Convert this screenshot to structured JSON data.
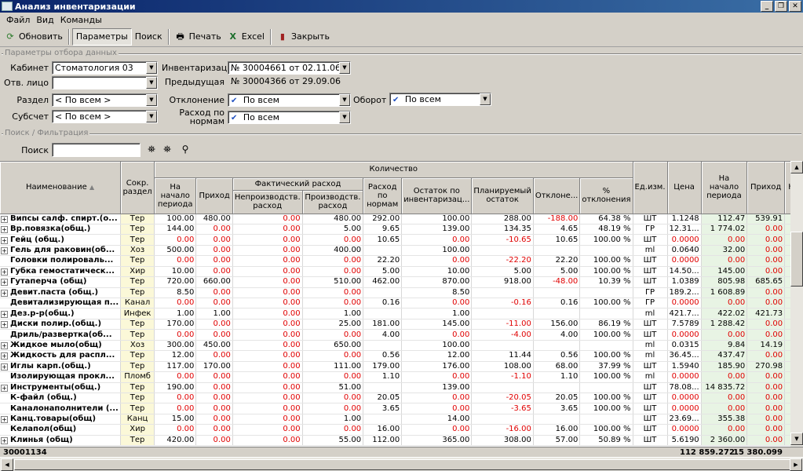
{
  "window": {
    "title": "Анализ инвентаризации"
  },
  "menu": [
    "Файл",
    "Вид",
    "Команды"
  ],
  "toolbar": {
    "refresh": "Обновить",
    "params": "Параметры",
    "search": "Поиск",
    "print": "Печать",
    "excel": "Excel",
    "close": "Закрыть"
  },
  "params": {
    "group_title": "Параметры отбора данных",
    "cabinet_label": "Кабинет",
    "cabinet_value": "Стоматология 03",
    "resp_label": "Отв. лицо",
    "resp_value": "",
    "section_label": "Раздел",
    "section_value": "< По всем >",
    "subaccount_label": "Субсчет",
    "subaccount_value": "< По всем >",
    "inventory_label": "Инвентаризация",
    "inventory_value": "№ 30004661 от 02.11.06",
    "prev_label": "Предыдущая",
    "prev_value": "№ 30004366 от 29.09.06",
    "deviation_label": "Отклонение",
    "deviation_value": "По всем",
    "turnover_label": "Оборот",
    "turnover_value": "По всем",
    "norm_label_1": "Расход по",
    "norm_label_2": "нормам",
    "norm_value": "По всем"
  },
  "filter": {
    "group_title": "Поиск / Фильтрация",
    "search_label": "Поиск",
    "search_value": ""
  },
  "grid": {
    "headers": {
      "name": "Наименование",
      "razdel": "Сокр. раздел",
      "qty": "Количество",
      "start": "На начало периода",
      "income": "Приход",
      "fact": "Фактический расход",
      "nonprod": "Непроизводств. расход",
      "prod": "Производств. расход",
      "norm": "Расход по нормам",
      "remain": "Остаток по инвентаризац...",
      "planned": "Планируемый остаток",
      "dev": "Отклоне...",
      "devpct": "% отклонения",
      "unit": "Ед.изм.",
      "price": "Цена",
      "sum_start": "На начало периода",
      "sum_income": "Приход",
      "sum_more": "Не"
    },
    "rows": [
      {
        "name": "Випсы салф. спирт.(о...",
        "exp": true,
        "razdel": "Тер",
        "start": "100.00",
        "income": "480.00",
        "nonprod": "0.00",
        "prod": "480.00",
        "norm": "292.00",
        "remain": "100.00",
        "planned": "288.00",
        "dev": "-188.00",
        "devpct": "64.38 %",
        "unit": "ШТ",
        "price": "1.1248",
        "s_start": "112.47",
        "s_income": "539.91"
      },
      {
        "name": "Вр.повязка(общ.)",
        "exp": true,
        "razdel": "Тер",
        "start": "144.00",
        "income": "0.00",
        "nonprod": "0.00",
        "prod": "5.00",
        "norm": "9.65",
        "remain": "139.00",
        "planned": "134.35",
        "dev": "4.65",
        "devpct": "48.19 %",
        "unit": "ГР",
        "price": "12.31...",
        "s_start": "1 774.02",
        "s_income": "0.00"
      },
      {
        "name": "Гейц (общ.)",
        "exp": true,
        "razdel": "Тер",
        "start": "0.00",
        "income": "0.00",
        "nonprod": "0.00",
        "prod": "0.00",
        "norm": "10.65",
        "remain": "0.00",
        "planned": "-10.65",
        "dev": "10.65",
        "devpct": "100.00 %",
        "unit": "ШТ",
        "price": "0.0000",
        "s_start": "0.00",
        "s_income": "0.00"
      },
      {
        "name": "Гель для раковин(об...",
        "exp": true,
        "razdel": "Хоз",
        "start": "500.00",
        "income": "0.00",
        "nonprod": "0.00",
        "prod": "400.00",
        "norm": "",
        "remain": "100.00",
        "planned": "",
        "dev": "",
        "devpct": "",
        "unit": "ml",
        "price": "0.0640",
        "s_start": "32.00",
        "s_income": "0.00"
      },
      {
        "name": "Головки полироваль...",
        "exp": false,
        "razdel": "Тер",
        "start": "0.00",
        "income": "0.00",
        "nonprod": "0.00",
        "prod": "0.00",
        "norm": "22.20",
        "remain": "0.00",
        "planned": "-22.20",
        "dev": "22.20",
        "devpct": "100.00 %",
        "unit": "ШТ",
        "price": "0.0000",
        "s_start": "0.00",
        "s_income": "0.00"
      },
      {
        "name": "Губка гемостатическ...",
        "exp": true,
        "razdel": "Хир",
        "start": "10.00",
        "income": "0.00",
        "nonprod": "0.00",
        "prod": "0.00",
        "norm": "5.00",
        "remain": "10.00",
        "planned": "5.00",
        "dev": "5.00",
        "devpct": "100.00 %",
        "unit": "ШТ",
        "price": "14.50...",
        "s_start": "145.00",
        "s_income": "0.00"
      },
      {
        "name": "Гутаперча (общ)",
        "exp": true,
        "razdel": "Тер",
        "start": "720.00",
        "income": "660.00",
        "nonprod": "0.00",
        "prod": "510.00",
        "norm": "462.00",
        "remain": "870.00",
        "planned": "918.00",
        "dev": "-48.00",
        "devpct": "10.39 %",
        "unit": "ШТ",
        "price": "1.0389",
        "s_start": "805.98",
        "s_income": "685.65"
      },
      {
        "name": "Девит.паста (общ.)",
        "exp": true,
        "razdel": "Тер",
        "start": "8.50",
        "income": "0.00",
        "nonprod": "0.00",
        "prod": "0.00",
        "norm": "",
        "remain": "8.50",
        "planned": "",
        "dev": "",
        "devpct": "",
        "unit": "ГР",
        "price": "189.2...",
        "s_start": "1 608.89",
        "s_income": "0.00"
      },
      {
        "name": "Девитализирующая п...",
        "exp": false,
        "razdel": "Канал",
        "start": "0.00",
        "income": "0.00",
        "nonprod": "0.00",
        "prod": "0.00",
        "norm": "0.16",
        "remain": "0.00",
        "planned": "-0.16",
        "dev": "0.16",
        "devpct": "100.00 %",
        "unit": "ГР",
        "price": "0.0000",
        "s_start": "0.00",
        "s_income": "0.00"
      },
      {
        "name": "Дез.р-р(общ.)",
        "exp": true,
        "razdel": "Инфек",
        "start": "1.00",
        "income": "1.00",
        "nonprod": "0.00",
        "prod": "1.00",
        "norm": "",
        "remain": "1.00",
        "planned": "",
        "dev": "",
        "devpct": "",
        "unit": "ml",
        "price": "421.7...",
        "s_start": "422.02",
        "s_income": "421.73"
      },
      {
        "name": "Диски полир.(общ.)",
        "exp": true,
        "razdel": "Тер",
        "start": "170.00",
        "income": "0.00",
        "nonprod": "0.00",
        "prod": "25.00",
        "norm": "181.00",
        "remain": "145.00",
        "planned": "-11.00",
        "dev": "156.00",
        "devpct": "86.19 %",
        "unit": "ШТ",
        "price": "7.5789",
        "s_start": "1 288.42",
        "s_income": "0.00"
      },
      {
        "name": "Дриль/развертка(об...",
        "exp": false,
        "razdel": "Тер",
        "start": "0.00",
        "income": "0.00",
        "nonprod": "0.00",
        "prod": "0.00",
        "norm": "4.00",
        "remain": "0.00",
        "planned": "-4.00",
        "dev": "4.00",
        "devpct": "100.00 %",
        "unit": "ШТ",
        "price": "0.0000",
        "s_start": "0.00",
        "s_income": "0.00"
      },
      {
        "name": "Жидкое мыло(общ)",
        "exp": true,
        "razdel": "Хоз",
        "start": "300.00",
        "income": "450.00",
        "nonprod": "0.00",
        "prod": "650.00",
        "norm": "",
        "remain": "100.00",
        "planned": "",
        "dev": "",
        "devpct": "",
        "unit": "ml",
        "price": "0.0315",
        "s_start": "9.84",
        "s_income": "14.19"
      },
      {
        "name": "Жидкость для распл...",
        "exp": true,
        "razdel": "Тер",
        "start": "12.00",
        "income": "0.00",
        "nonprod": "0.00",
        "prod": "0.00",
        "norm": "0.56",
        "remain": "12.00",
        "planned": "11.44",
        "dev": "0.56",
        "devpct": "100.00 %",
        "unit": "ml",
        "price": "36.45...",
        "s_start": "437.47",
        "s_income": "0.00"
      },
      {
        "name": "Иглы карп.(общ.)",
        "exp": true,
        "razdel": "Тер",
        "start": "117.00",
        "income": "170.00",
        "nonprod": "0.00",
        "prod": "111.00",
        "norm": "179.00",
        "remain": "176.00",
        "planned": "108.00",
        "dev": "68.00",
        "devpct": "37.99 %",
        "unit": "ШТ",
        "price": "1.5940",
        "s_start": "185.90",
        "s_income": "270.98"
      },
      {
        "name": "Изолирующая прокл...",
        "exp": false,
        "razdel": "Пломб",
        "start": "0.00",
        "income": "0.00",
        "nonprod": "0.00",
        "prod": "0.00",
        "norm": "1.10",
        "remain": "0.00",
        "planned": "-1.10",
        "dev": "1.10",
        "devpct": "100.00 %",
        "unit": "ml",
        "price": "0.0000",
        "s_start": "0.00",
        "s_income": "0.00"
      },
      {
        "name": "Инструменты(общ.)",
        "exp": true,
        "razdel": "Тер",
        "start": "190.00",
        "income": "0.00",
        "nonprod": "0.00",
        "prod": "51.00",
        "norm": "",
        "remain": "139.00",
        "planned": "",
        "dev": "",
        "devpct": "",
        "unit": "ШТ",
        "price": "78.08...",
        "s_start": "14 835.72",
        "s_income": "0.00"
      },
      {
        "name": "К-файл (общ.)",
        "exp": false,
        "razdel": "Тер",
        "start": "0.00",
        "income": "0.00",
        "nonprod": "0.00",
        "prod": "0.00",
        "norm": "20.05",
        "remain": "0.00",
        "planned": "-20.05",
        "dev": "20.05",
        "devpct": "100.00 %",
        "unit": "ШТ",
        "price": "0.0000",
        "s_start": "0.00",
        "s_income": "0.00"
      },
      {
        "name": "Каналонаполнители (...",
        "exp": false,
        "razdel": "Тер",
        "start": "0.00",
        "income": "0.00",
        "nonprod": "0.00",
        "prod": "0.00",
        "norm": "3.65",
        "remain": "0.00",
        "planned": "-3.65",
        "dev": "3.65",
        "devpct": "100.00 %",
        "unit": "ШТ",
        "price": "0.0000",
        "s_start": "0.00",
        "s_income": "0.00"
      },
      {
        "name": "Канц.товары(общ)",
        "exp": true,
        "razdel": "Канц",
        "start": "15.00",
        "income": "0.00",
        "nonprod": "0.00",
        "prod": "1.00",
        "norm": "",
        "remain": "14.00",
        "planned": "",
        "dev": "",
        "devpct": "",
        "unit": "ШТ",
        "price": "23.69...",
        "s_start": "355.38",
        "s_income": "0.00"
      },
      {
        "name": "Келапол(общ)",
        "exp": false,
        "razdel": "Хир",
        "start": "0.00",
        "income": "0.00",
        "nonprod": "0.00",
        "prod": "0.00",
        "norm": "16.00",
        "remain": "0.00",
        "planned": "-16.00",
        "dev": "16.00",
        "devpct": "100.00 %",
        "unit": "ШТ",
        "price": "0.0000",
        "s_start": "0.00",
        "s_income": "0.00"
      },
      {
        "name": "Клинья (общ)",
        "exp": true,
        "razdel": "Тер",
        "start": "420.00",
        "income": "0.00",
        "nonprod": "0.00",
        "prod": "55.00",
        "norm": "112.00",
        "remain": "365.00",
        "planned": "308.00",
        "dev": "57.00",
        "devpct": "50.89 %",
        "unit": "ШТ",
        "price": "5.6190",
        "s_start": "2 360.00",
        "s_income": "0.00"
      }
    ],
    "footer": {
      "count": "30001134",
      "sum_start": "112 859.272",
      "sum_income": "15 380.099"
    }
  },
  "colors": {
    "negative": "#e00000",
    "razdel_bg": "#fbf8d8",
    "sum_bg": "#e8f4e4",
    "titlebar": "#0a246a"
  }
}
